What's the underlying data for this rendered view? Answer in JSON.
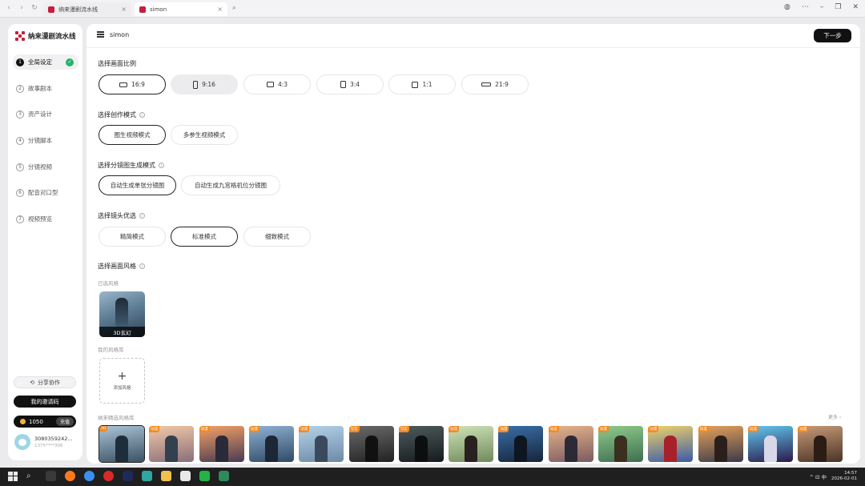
{
  "browser": {
    "nav": [
      "‹",
      "›",
      "↻"
    ],
    "tabs": [
      {
        "title": "纳来漫剧流水线",
        "active": false
      },
      {
        "title": "simon",
        "active": true
      }
    ],
    "right_icons": [
      "globe-icon",
      "more-icon",
      "minimize-icon",
      "restore-icon",
      "close-icon"
    ]
  },
  "sidebar": {
    "brand": "纳来漫剧流水线",
    "steps": [
      {
        "num": "1",
        "label": "全局设定",
        "active": true,
        "done": true
      },
      {
        "num": "2",
        "label": "故事剧本",
        "active": false,
        "done": false
      },
      {
        "num": "3",
        "label": "资产设计",
        "active": false,
        "done": false
      },
      {
        "num": "4",
        "label": "分镜脚本",
        "active": false,
        "done": false
      },
      {
        "num": "5",
        "label": "分镜视频",
        "active": false,
        "done": false
      },
      {
        "num": "6",
        "label": "配音对口型",
        "active": false,
        "done": false
      },
      {
        "num": "7",
        "label": "视频预览",
        "active": false,
        "done": false
      }
    ],
    "collab_label": "分享协作",
    "invite_label": "我的邀请码",
    "credits": "1050",
    "recharge_label": "充值",
    "user_name": "3080359242...",
    "user_sub": "1375****306"
  },
  "header": {
    "project": "simon",
    "next_label": "下一步"
  },
  "sections": {
    "ratio": {
      "title": "选择画面比例",
      "options": [
        "16:9",
        "9:16",
        "4:3",
        "3:4",
        "1:1",
        "21:9"
      ]
    },
    "mode": {
      "title": "选择创作模式",
      "options": [
        "图生视频模式",
        "多参生视频模式"
      ]
    },
    "storyboard": {
      "title": "选择分镜图生成模式",
      "options": [
        "自动生成单张分镜图",
        "自动生成九宫格机位分镜图"
      ]
    },
    "shot": {
      "title": "选择镜头优选",
      "options": [
        "精简模式",
        "标准模式",
        "细致模式"
      ]
    },
    "style": {
      "title": "选择画面风格",
      "used_label": "已选风格",
      "selected_style": "3D玄幻",
      "custom_label": "我的风格库",
      "add_label": "添加风格",
      "library_label": "纳来精选风格库",
      "more_label": "更多"
    }
  },
  "library_thumbs": [
    {
      "badge": "3D",
      "bg1": "#aac3d6",
      "bg2": "#3b5164",
      "fig": "#1e2d3c"
    },
    {
      "badge": "动漫",
      "bg1": "#f2c9a8",
      "bg2": "#8a6e7a",
      "fig": "#32404f"
    },
    {
      "badge": "动漫",
      "bg1": "#f3a167",
      "bg2": "#4a3a52",
      "fig": "#2a2a38"
    },
    {
      "badge": "动漫",
      "bg1": "#8fb1d2",
      "bg2": "#2f4a66",
      "fig": "#1c2735"
    },
    {
      "badge": "动漫",
      "bg1": "#b4d2e8",
      "bg2": "#6c8aa6",
      "fig": "#3a4a5c"
    },
    {
      "badge": "写实",
      "bg1": "#6a6a6a",
      "bg2": "#222222",
      "fig": "#111111"
    },
    {
      "badge": "写实",
      "bg1": "#4f5b5e",
      "bg2": "#161b1d",
      "fig": "#0c0f10"
    },
    {
      "badge": "动漫",
      "bg1": "#cfe3b8",
      "bg2": "#6f8a5a",
      "fig": "#2a2020"
    },
    {
      "badge": "动漫",
      "bg1": "#3a6fa8",
      "bg2": "#16243a",
      "fig": "#0e1622"
    },
    {
      "badge": "动漫",
      "bg1": "#e7b58a",
      "bg2": "#7a5a62",
      "fig": "#2d2a38"
    },
    {
      "badge": "动漫",
      "bg1": "#8ecb8a",
      "bg2": "#3f6e52",
      "fig": "#3b3020"
    },
    {
      "badge": "动漫",
      "bg1": "#f0d26a",
      "bg2": "#3a5aa8",
      "fig": "#a8202a"
    },
    {
      "badge": "动漫",
      "bg1": "#e6a15a",
      "bg2": "#3a3a4a",
      "fig": "#2a1f1a"
    },
    {
      "badge": "动漫",
      "bg1": "#62c8f0",
      "bg2": "#2a1a4a",
      "fig": "#d8d8e8"
    },
    {
      "badge": "动漫",
      "bg1": "#c89a78",
      "bg2": "#4a3426",
      "fig": "#2b1d16"
    }
  ],
  "taskbar": {
    "apps": [
      "start-icon",
      "search-icon",
      "taskview-icon",
      "firefox-icon",
      "chrome-icon",
      "app-red-icon",
      "photoshop-icon",
      "app-teal-icon",
      "files-icon",
      "docs-icon",
      "wechat-icon",
      "terminal-icon"
    ],
    "tray": "^  ⊡  中",
    "time": "14:57",
    "date": "2026-02-01"
  }
}
